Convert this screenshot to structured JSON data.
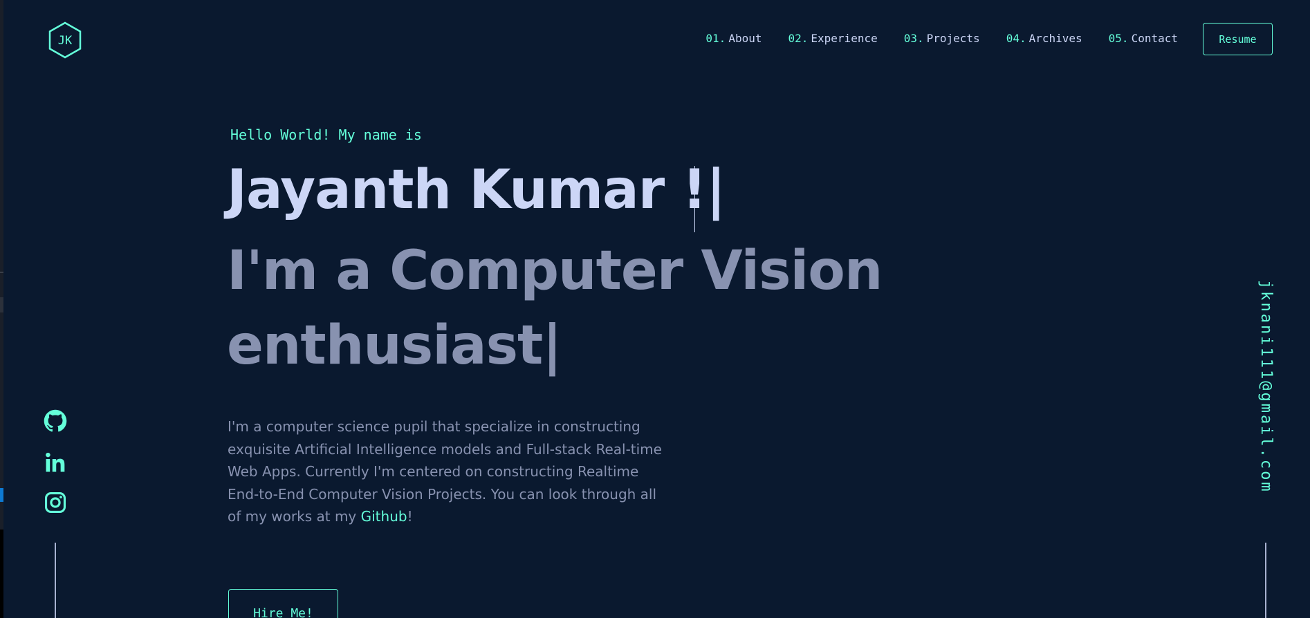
{
  "logo": {
    "text": "JK",
    "icon": "hexagon-logo-icon"
  },
  "nav": [
    {
      "num": "01.",
      "label": "About"
    },
    {
      "num": "02.",
      "label": "Experience"
    },
    {
      "num": "03.",
      "label": "Projects"
    },
    {
      "num": "04.",
      "label": "Archives"
    },
    {
      "num": "05.",
      "label": "Contact"
    }
  ],
  "resume_label": "Resume",
  "hero": {
    "greeting": "Hello World! My name is",
    "name": "Jayanth Kumar !|",
    "tagline_line1": "I'm a Computer Vision",
    "tagline_line2": "enthusiast|",
    "bio_text": "I'm a computer science pupil that specialize in constructing exquisite Artificial Intelligence models and Full-stack Real-time Web Apps. Currently I'm centered on constructing Realtime End-to-End Computer Vision Projects. You can look through all of my works at my ",
    "bio_link": "Github",
    "bio_end": "!",
    "hire_label": "Hire Me!"
  },
  "socials": [
    {
      "icon": "github-icon"
    },
    {
      "icon": "linkedin-icon"
    },
    {
      "icon": "instagram-icon"
    }
  ],
  "email": "jknani111@gmail.com",
  "colors": {
    "background": "#0a192f",
    "accent": "#64ffda",
    "heading": "#ccd6f6",
    "text": "#8892b0"
  }
}
